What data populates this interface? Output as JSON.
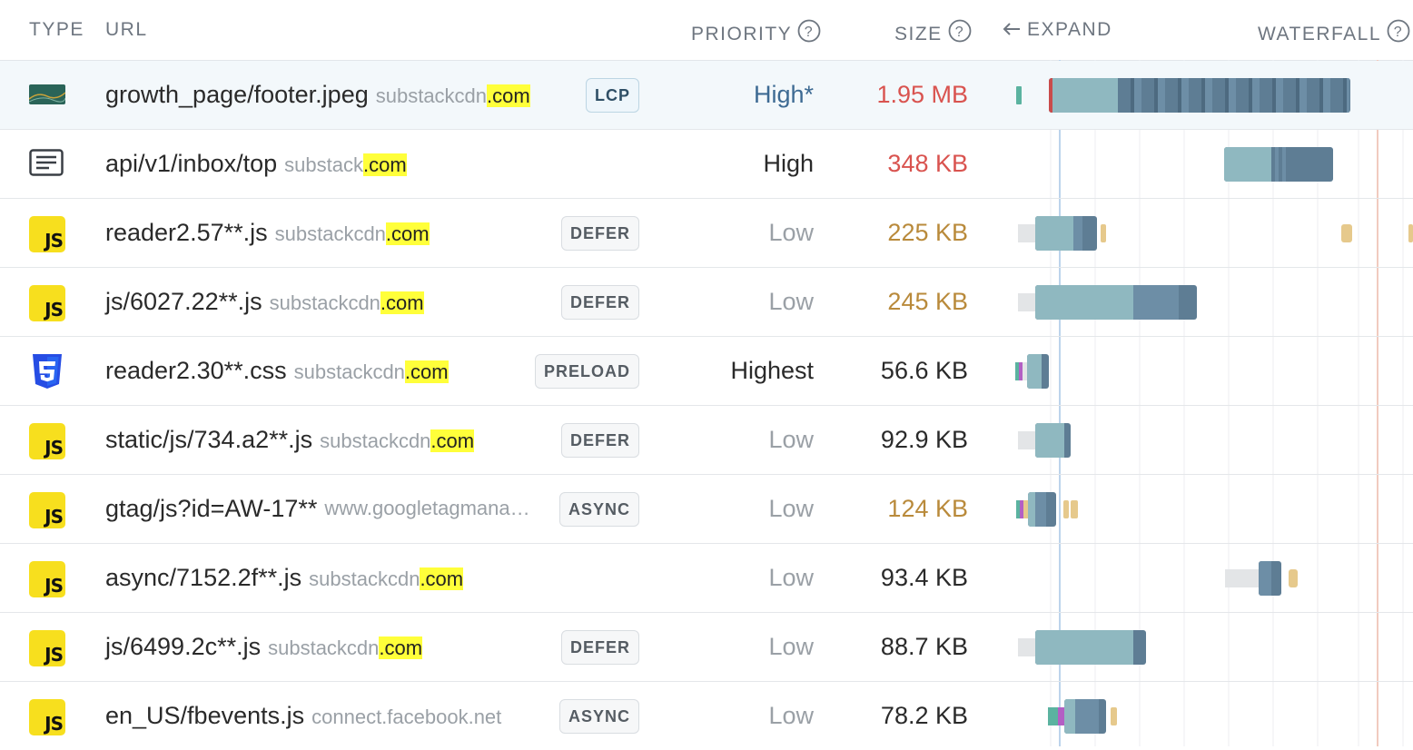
{
  "header": {
    "type": "TYPE",
    "url": "URL",
    "priority": "PRIORITY",
    "size": "SIZE",
    "expand": "EXPAND",
    "waterfall": "WATERFALL"
  },
  "colors": {
    "size_red": "#d9534f",
    "size_orange": "#b98a3b",
    "prio_blue": "#3d6a93",
    "text_dark": "#2a2a2a",
    "text_muted": "#9aa0a6",
    "tld_highlight": "#ffff3a"
  },
  "rows": [
    {
      "type": "image",
      "path": "growth_page/footer.jpeg",
      "host": "substackcdn",
      "tld": ".com",
      "badge": "LCP",
      "priority": "High*",
      "size": "1.95 MB"
    },
    {
      "type": "document",
      "path": "api/v1/inbox/top",
      "host": "substack",
      "tld": ".com",
      "badge": "",
      "priority": "High",
      "size": "348 KB"
    },
    {
      "type": "js",
      "path": "reader2.57**.js",
      "host": "substackcdn",
      "tld": ".com",
      "badge": "DEFER",
      "priority": "Low",
      "size": "225 KB"
    },
    {
      "type": "js",
      "path": "js/6027.22**.js",
      "host": "substackcdn",
      "tld": ".com",
      "badge": "DEFER",
      "priority": "Low",
      "size": "245 KB"
    },
    {
      "type": "css",
      "path": "reader2.30**.css",
      "host": "substackcdn",
      "tld": ".com",
      "badge": "PRELOAD",
      "priority": "Highest",
      "size": "56.6 KB"
    },
    {
      "type": "js",
      "path": "static/js/734.a2**.js",
      "host": "substackcdn",
      "tld": ".com",
      "badge": "DEFER",
      "priority": "Low",
      "size": "92.9 KB"
    },
    {
      "type": "js",
      "path": "gtag/js?id=AW-17**",
      "host": "www.googletagmanag…",
      "tld": "",
      "badge": "ASYNC",
      "priority": "Low",
      "size": "124 KB"
    },
    {
      "type": "js",
      "path": "async/7152.2f**.js",
      "host": "substackcdn",
      "tld": ".com",
      "badge": "",
      "priority": "Low",
      "size": "93.4 KB"
    },
    {
      "type": "js",
      "path": "js/6499.2c**.js",
      "host": "substackcdn",
      "tld": ".com",
      "badge": "DEFER",
      "priority": "Low",
      "size": "88.7 KB"
    },
    {
      "type": "js",
      "path": "en_US/fbevents.js",
      "host": "connect.facebook.net",
      "tld": "",
      "badge": "ASYNC",
      "priority": "Low",
      "size": "78.2 KB"
    }
  ],
  "icons": {
    "image": "image-thumbnail-icon",
    "document": "document-lines-icon",
    "js": "javascript-file-icon",
    "css": "css3-file-icon",
    "help": "question-circle-icon",
    "expand": "arrow-left-icon"
  },
  "js_icon_text": "JS"
}
